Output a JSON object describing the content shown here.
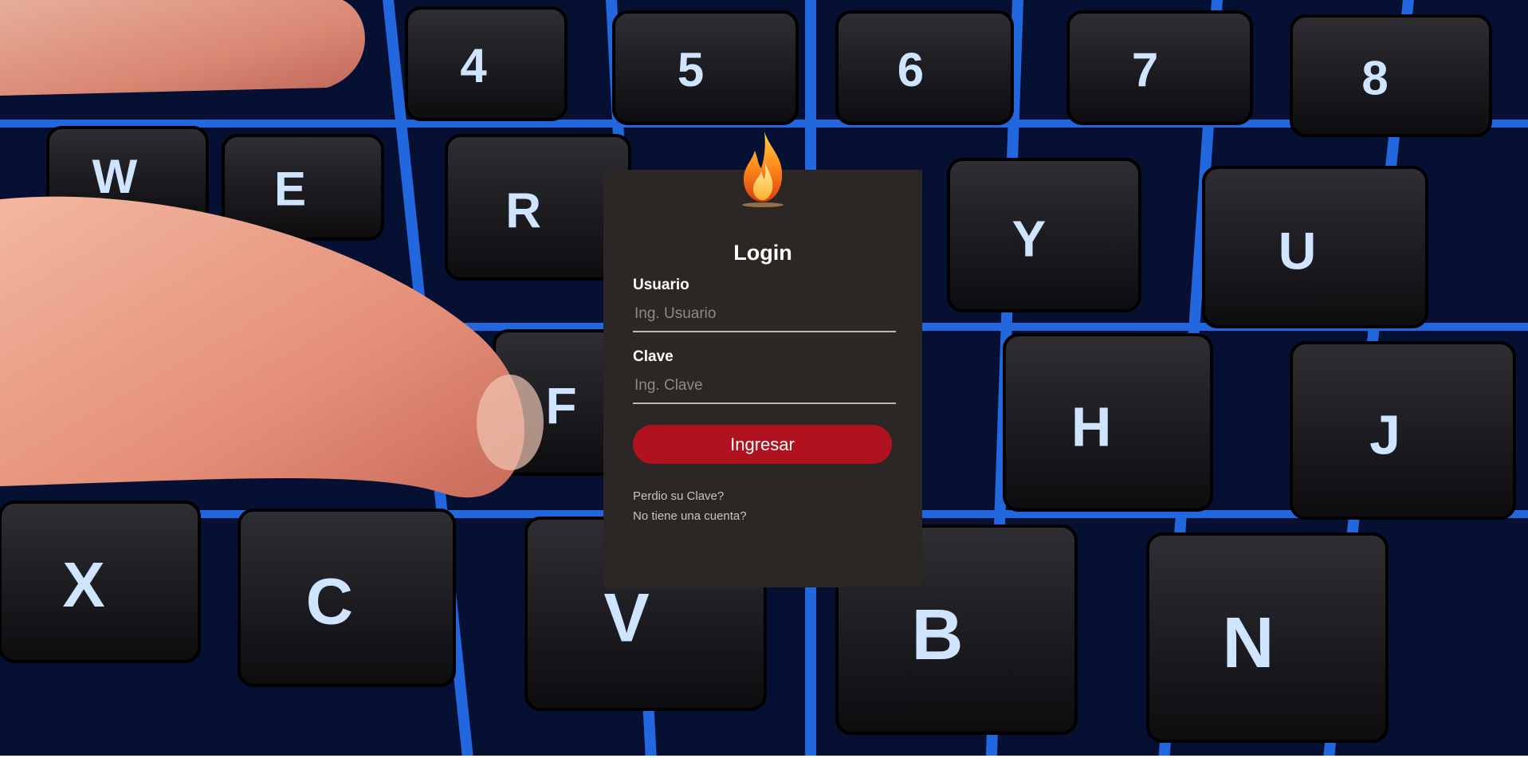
{
  "login": {
    "title": "Login",
    "logo_icon": "flame-icon",
    "username": {
      "label": "Usuario",
      "placeholder": "Ing. Usuario",
      "value": ""
    },
    "password": {
      "label": "Clave",
      "placeholder": "Ing. Clave",
      "value": ""
    },
    "submit_label": "Ingresar",
    "forgot_password_link": "Perdio su Clave?",
    "no_account_link": "No tiene una cuenta?"
  },
  "background": {
    "keys": [
      "4",
      "5",
      "6",
      "7",
      "8",
      "W",
      "E",
      "R",
      "Y",
      "U",
      "F",
      "H",
      "J",
      "X",
      "C",
      "V",
      "B",
      "N"
    ]
  },
  "colors": {
    "card_background": "#2b2725",
    "button": "#b0121f",
    "key_glow": "#1f6dff"
  }
}
